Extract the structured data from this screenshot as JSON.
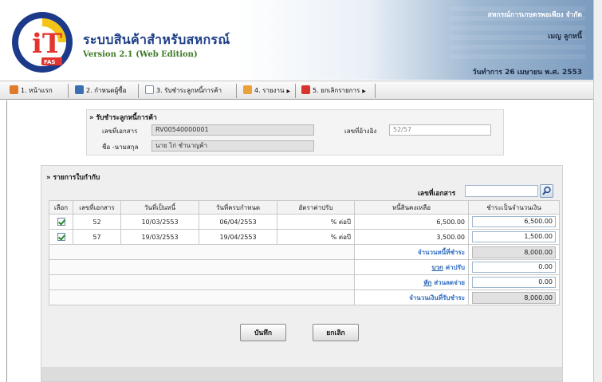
{
  "header": {
    "app_title": "ระบบสินค้าสำหรับสหกรณ์",
    "version": "Version 2.1 (Web Edition)",
    "organization": "สหกรณ์การเกษตรพอเพียง จำกัด",
    "user_name": "เมญ ลูกหนี้",
    "work_date": "วันทำการ 26 เมษายน พ.ศ. 2553",
    "logo_text": "iT",
    "logo_ring_text": "Fair Trade Accounting Software",
    "logo_badge": "FAS",
    "colors": {
      "title": "#1f3f86",
      "version": "#3d7a22",
      "logo_ring": "#1d3a8a",
      "logo_accent": "#e3342f"
    }
  },
  "menu": [
    {
      "label": "1. หน้าแรก",
      "icon": "home-icon",
      "has_submenu": false
    },
    {
      "label": "2. กำหนดผู้ซื้อ",
      "icon": "people-icon",
      "has_submenu": false
    },
    {
      "label": "3. รับชำระลูกหนี้การค้า",
      "icon": "document-icon",
      "has_submenu": false
    },
    {
      "label": "4. รายงาน",
      "icon": "report-icon",
      "has_submenu": true
    },
    {
      "label": "5. ยกเลิกรายการ",
      "icon": "cancel-doc-icon",
      "has_submenu": true
    }
  ],
  "receipt": {
    "title": "» รับชำระลูกหนี้การค้า",
    "doc_no_label": "เลขที่เอกสาร",
    "doc_no": "RV00540000001",
    "ref_no_label": "เลขที่อ้างอิง",
    "ref_no": "52/57",
    "name_label": "ชื่อ -นามสกุล",
    "name": "นาย ไก่ ชำนาญค้า"
  },
  "details": {
    "title": "» รายการใบกำกับ",
    "search_label": "เลขที่เอกสาร",
    "search_value": "",
    "columns": [
      "เลือก",
      "เลขที่เอกสาร",
      "วันที่เป็นหนี้",
      "วันที่ครบกำหนด",
      "อัตราค่าปรับ",
      "หนี้สินคงเหลือ",
      "ชำระเป็นจำนวนเงิน"
    ],
    "rows": [
      {
        "checked": true,
        "doc_no": "52",
        "debt_date": "10/03/2553",
        "due_date": "06/04/2553",
        "fine_rate": "% ต่อปี",
        "balance": "6,500.00",
        "pay_amount": "6,500.00"
      },
      {
        "checked": true,
        "doc_no": "57",
        "debt_date": "19/03/2553",
        "due_date": "19/04/2553",
        "fine_rate": "% ต่อปี",
        "balance": "3,500.00",
        "pay_amount": "1,500.00"
      }
    ],
    "summary": {
      "total_debt_label": "จำนวนหนี้ที่ชำระ",
      "total_debt": "8,000.00",
      "fee_link": "บวก",
      "fee_label": "ค่าปรับ",
      "fee": "0.00",
      "discount_link": "หัก",
      "discount_label": "ส่วนลดจ่าย",
      "discount": "0.00",
      "received_label": "จำนวนเงินที่รับชำระ",
      "received": "8,000.00"
    }
  },
  "buttons": {
    "save": "บันทึก",
    "cancel": "ยกเลิก"
  }
}
